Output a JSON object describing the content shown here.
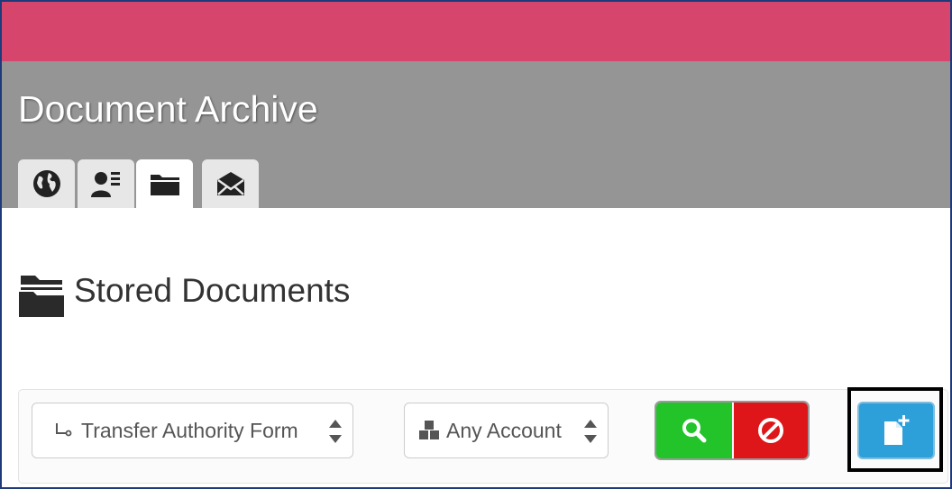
{
  "app": {
    "title": "Document Archive",
    "accent_color": "#d5456c",
    "header_color": "#959595"
  },
  "tabs": [
    {
      "name": "globe",
      "icon": "globe-icon",
      "active": false
    },
    {
      "name": "contacts",
      "icon": "user-card-icon",
      "active": false
    },
    {
      "name": "documents",
      "icon": "folder-icon",
      "active": true
    },
    {
      "name": "mail",
      "icon": "envelope-icon",
      "active": false
    }
  ],
  "section": {
    "title": "Stored Documents",
    "icon": "folder-icon"
  },
  "filters": {
    "document_type": {
      "selected": "Transfer Authority Form",
      "icon": "level-down-icon"
    },
    "account": {
      "selected": "Any Account",
      "icon": "cubes-icon"
    }
  },
  "actions": {
    "search": {
      "icon": "search-icon",
      "color": "#22c42a"
    },
    "reset": {
      "icon": "ban-icon",
      "color": "#de1519"
    },
    "new_document": {
      "icon": "file-plus-icon",
      "color": "#2d9fd9",
      "highlighted": true
    }
  }
}
